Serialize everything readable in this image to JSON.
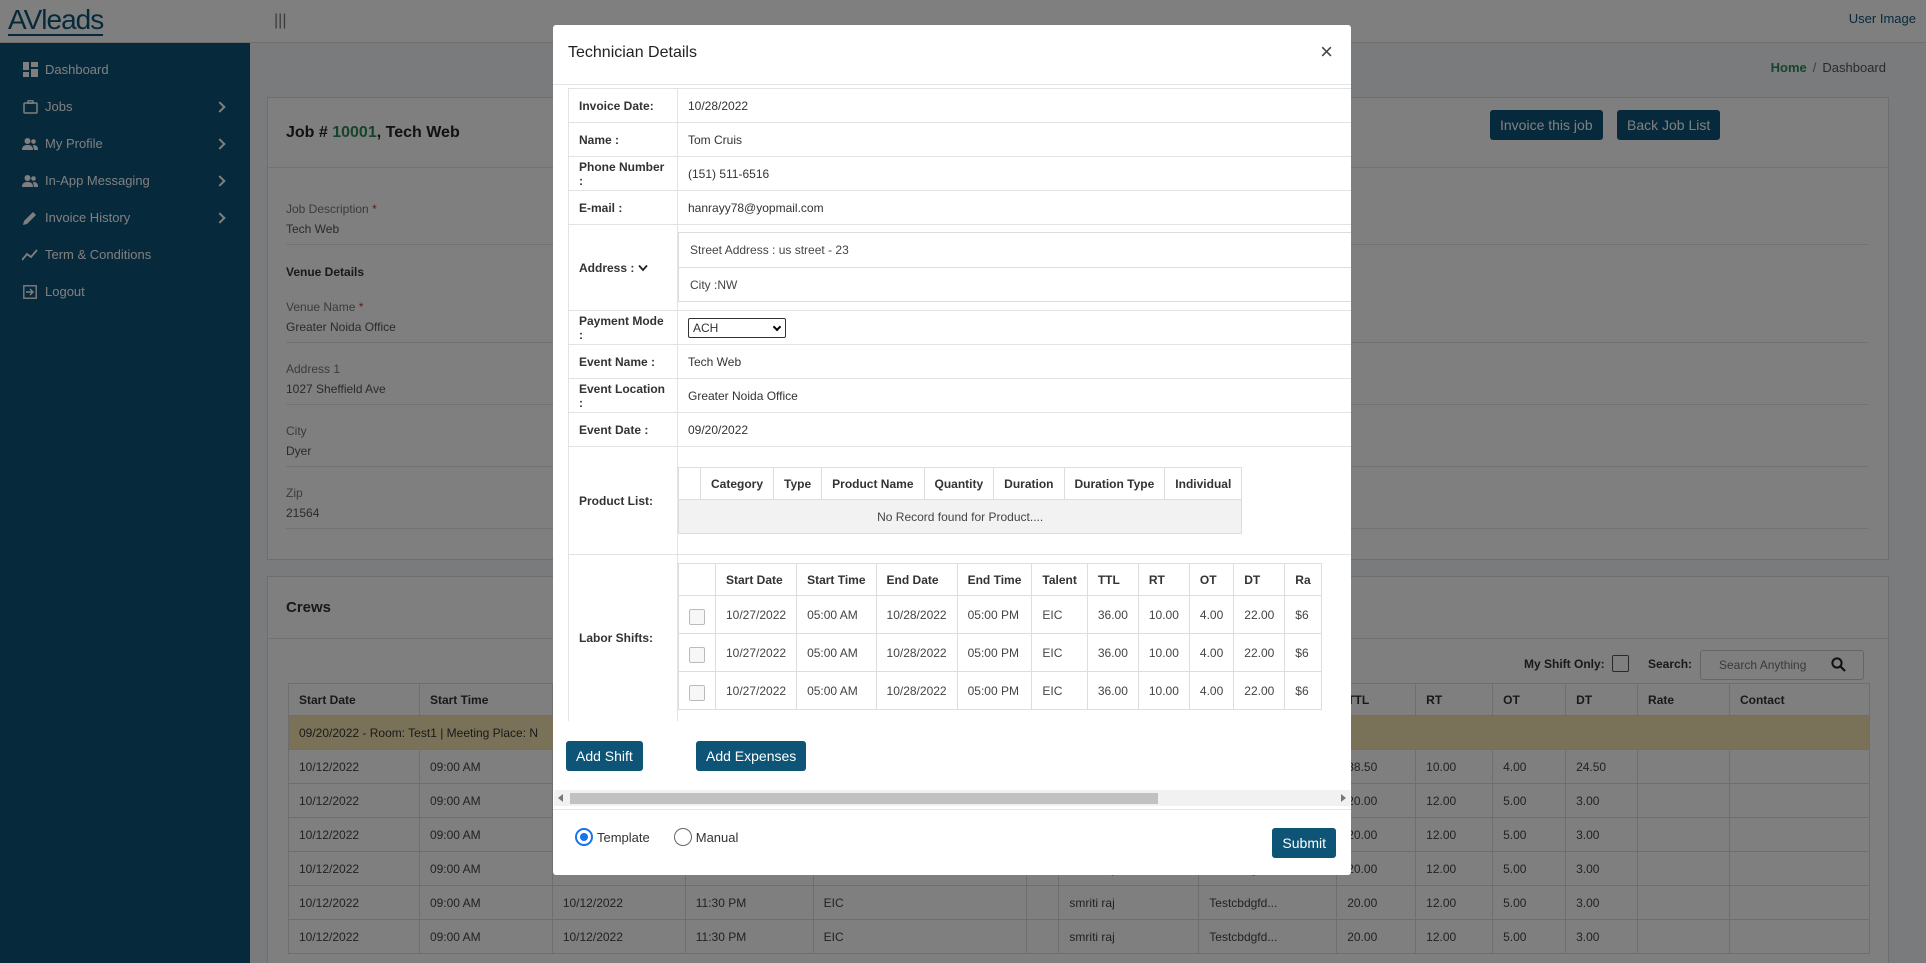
{
  "app": {
    "logo": "AVleads",
    "user_image_alt": "User Image",
    "menu_toggle": "|||"
  },
  "sidebar": {
    "items": [
      {
        "label": "Dashboard",
        "icon": "dashboard-icon",
        "has_children": false
      },
      {
        "label": "Jobs",
        "icon": "briefcase-icon",
        "has_children": true
      },
      {
        "label": "My Profile",
        "icon": "users-icon",
        "has_children": true
      },
      {
        "label": "In-App Messaging",
        "icon": "users-icon",
        "has_children": true
      },
      {
        "label": "Invoice History",
        "icon": "pencil-icon",
        "has_children": true
      },
      {
        "label": "Term & Conditions",
        "icon": "chart-line-icon",
        "has_children": false
      },
      {
        "label": "Logout",
        "icon": "logout-icon",
        "has_children": false
      }
    ]
  },
  "breadcrumb": {
    "home": "Home",
    "sep": "/",
    "current": "Dashboard"
  },
  "job": {
    "prefix": "Job # ",
    "number": "10001",
    "suffix": ", Tech Web",
    "invoice_button": "Invoice this job",
    "back_button": "Back Job List",
    "description_label": "Job Description",
    "description_value": "Tech Web",
    "venue_details": "Venue Details",
    "venue_name_label": "Venue Name",
    "venue_name_value": "Greater Noida Office",
    "address_label": "Address 1",
    "address_value": "1027 Sheffield Ave",
    "city_label": "City",
    "city_value": "Dyer",
    "zip_label": "Zip",
    "zip_value": "21564",
    "required_mark": "*"
  },
  "crews": {
    "title": "Crews",
    "my_shift_only": "My Shift Only:",
    "search_label": "Search:",
    "search_placeholder": "Search Anything",
    "headers": [
      "Start Date",
      "Start Time",
      "",
      "",
      "",
      "",
      "",
      "",
      "TTL",
      "RT",
      "OT",
      "DT",
      "Rate",
      "Contact"
    ],
    "group_row": "09/20/2022 - Room: Test1 | Meeting Place: N",
    "rows": [
      [
        "10/12/2022",
        "09:00 AM",
        "",
        "",
        "",
        "",
        "",
        "",
        "38.50",
        "10.00",
        "4.00",
        "24.50",
        "",
        ""
      ],
      [
        "10/12/2022",
        "09:00 AM",
        "",
        "",
        "",
        "",
        "",
        "",
        "20.00",
        "12.00",
        "5.00",
        "3.00",
        "",
        ""
      ],
      [
        "10/12/2022",
        "09:00 AM",
        "",
        "",
        "",
        "",
        "",
        "",
        "20.00",
        "12.00",
        "5.00",
        "3.00",
        "",
        ""
      ],
      [
        "10/12/2022",
        "09:00 AM",
        "10/12/2022",
        "11:30 PM",
        "EIC",
        "",
        "smriti raj",
        "Testcbdgfd...",
        "20.00",
        "12.00",
        "5.00",
        "3.00",
        "",
        ""
      ],
      [
        "10/12/2022",
        "09:00 AM",
        "10/12/2022",
        "11:30 PM",
        "EIC",
        "",
        "smriti raj",
        "Testcbdgfd...",
        "20.00",
        "12.00",
        "5.00",
        "3.00",
        "",
        ""
      ],
      [
        "10/12/2022",
        "09:00 AM",
        "10/12/2022",
        "11:30 PM",
        "EIC",
        "",
        "smriti raj",
        "Testcbdgfd...",
        "20.00",
        "12.00",
        "5.00",
        "3.00",
        "",
        ""
      ]
    ]
  },
  "modal": {
    "title": "Technician Details",
    "close": "×",
    "invoice_date_label": "Invoice Date:",
    "invoice_date": "10/28/2022",
    "name_label": "Name :",
    "name": "Tom Cruis",
    "phone_label": "Phone Number :",
    "phone": "(151) 511-6516",
    "email_label": "E-mail :",
    "email": "hanrayy78@yopmail.com",
    "address_label": "Address :",
    "street": "Street Address : us street - 23",
    "city": "City :NW",
    "payment_label": "Payment Mode :",
    "payment_value": "ACH",
    "event_name_label": "Event Name :",
    "event_name": "Tech Web",
    "event_location_label": "Event Location :",
    "event_location": "Greater Noida Office",
    "event_date_label": "Event Date :",
    "event_date": "09/20/2022",
    "product_label": "Product List:",
    "product_headers": [
      "",
      "Category",
      "Type",
      "Product Name",
      "Quantity",
      "Duration",
      "Duration Type",
      "Individual"
    ],
    "product_empty": "No Record found for Product....",
    "labor_label": "Labor Shifts:",
    "labor_headers": [
      "",
      "Start Date",
      "Start Time",
      "End Date",
      "End Time",
      "Talent",
      "TTL",
      "RT",
      "OT",
      "DT",
      "Ra"
    ],
    "labor_rows": [
      [
        "10/27/2022",
        "05:00 AM",
        "10/28/2022",
        "05:00 PM",
        "EIC",
        "36.00",
        "10.00",
        "4.00",
        "22.00",
        "$6"
      ],
      [
        "10/27/2022",
        "05:00 AM",
        "10/28/2022",
        "05:00 PM",
        "EIC",
        "36.00",
        "10.00",
        "4.00",
        "22.00",
        "$6"
      ],
      [
        "10/27/2022",
        "05:00 AM",
        "10/28/2022",
        "05:00 PM",
        "EIC",
        "36.00",
        "10.00",
        "4.00",
        "22.00",
        "$6"
      ]
    ],
    "add_shift": "Add Shift",
    "add_expenses": "Add Expenses",
    "radio_template": "Template",
    "radio_manual": "Manual",
    "submit": "Submit"
  },
  "colors": {
    "primary": "#0d5477",
    "accent_green": "#2e8b57",
    "group_row": "#f5e4b0"
  }
}
